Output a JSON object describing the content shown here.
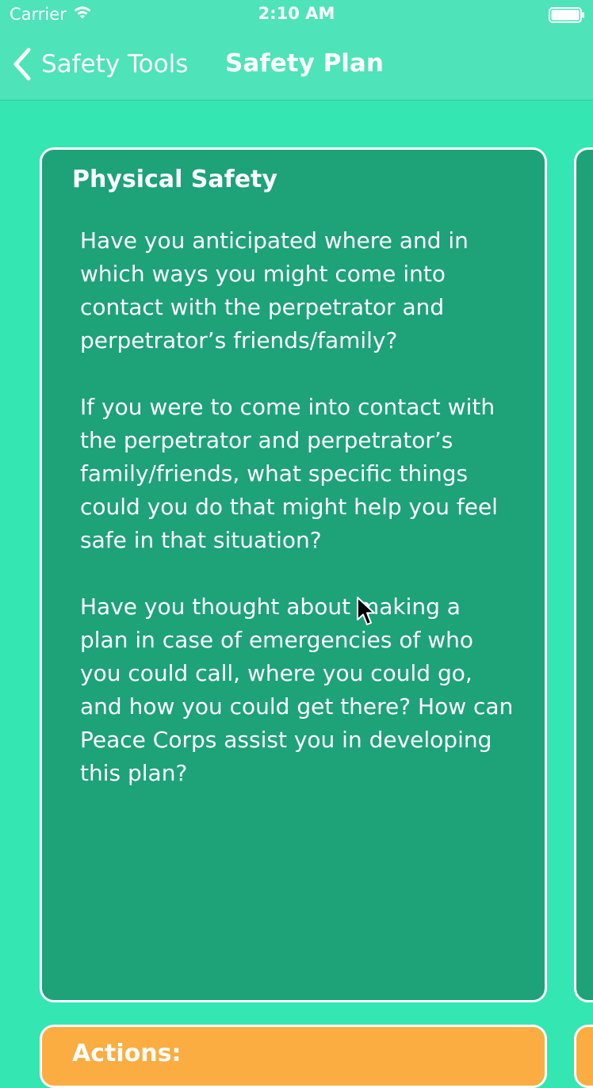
{
  "status_bar": {
    "carrier": "Carrier",
    "time": "2:10 AM",
    "wifi_icon": "wifi-icon",
    "battery_icon": "battery-icon"
  },
  "nav": {
    "back_label": "Safety Tools",
    "back_icon": "chevron-left-icon",
    "title": "Safety Plan"
  },
  "card": {
    "title": "Physical Safety",
    "paragraphs": [
      "Have you anticipated where and in which ways you might come into contact with the perpetrator and perpetrator’s friends/family?",
      "If you were to come into contact with the perpetrator and perpetrator’s family/friends, what specific things could you do that might help you feel safe in that situation?",
      "Have you thought about making a plan in case of emergencies of who you could call, where you could go, and how you could get there? How can Peace Corps assist you in developing this plan?"
    ]
  },
  "actions_card": {
    "title": "Actions:"
  },
  "colors": {
    "background": "#33e6b2",
    "nav_bar": "#4ee3b8",
    "card": "#1ea278",
    "actions_card": "#fbad42",
    "text": "#ffffff"
  }
}
